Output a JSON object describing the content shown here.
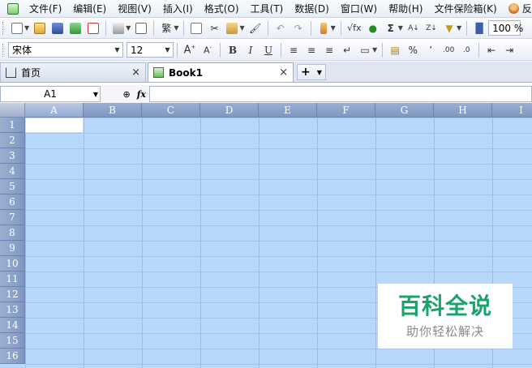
{
  "menubar": {
    "items": [
      "文件(F)",
      "编辑(E)",
      "视图(V)",
      "插入(I)",
      "格式(O)",
      "工具(T)",
      "数据(D)",
      "窗口(W)",
      "帮助(H)",
      "文件保险箱(K)",
      "反"
    ]
  },
  "toolbar2": {
    "font_name": "宋体",
    "font_size": "12",
    "bold": "B",
    "italic": "I",
    "underline": "U",
    "percent": "%",
    "comma": "’",
    "inc_decimal": ".00",
    "dec_decimal": ".0"
  },
  "toolbar1": {
    "traditional": "繁",
    "sqrt": "√fx",
    "sum": "Σ",
    "zoom": "100 %"
  },
  "tabs": {
    "home_label": "首页",
    "book_label": "Book1",
    "close_glyph": "×",
    "new_glyph": "+"
  },
  "formula_bar": {
    "name_box": "A1",
    "fx_label": "fx",
    "formula_value": ""
  },
  "grid": {
    "columns": [
      "A",
      "B",
      "C",
      "D",
      "E",
      "F",
      "G",
      "H",
      "I"
    ],
    "rows": [
      "1",
      "2",
      "3",
      "4",
      "5",
      "6",
      "7",
      "8",
      "9",
      "10",
      "11",
      "12",
      "13",
      "14",
      "15",
      "16"
    ],
    "active_cell": "A1"
  },
  "watermark": {
    "title": "百科全说",
    "subtitle": "助你轻松解决"
  },
  "colors": {
    "grid_bg": "#b8d8fb",
    "header_blue": "#8098c2",
    "watermark_green": "#1aa36b"
  }
}
